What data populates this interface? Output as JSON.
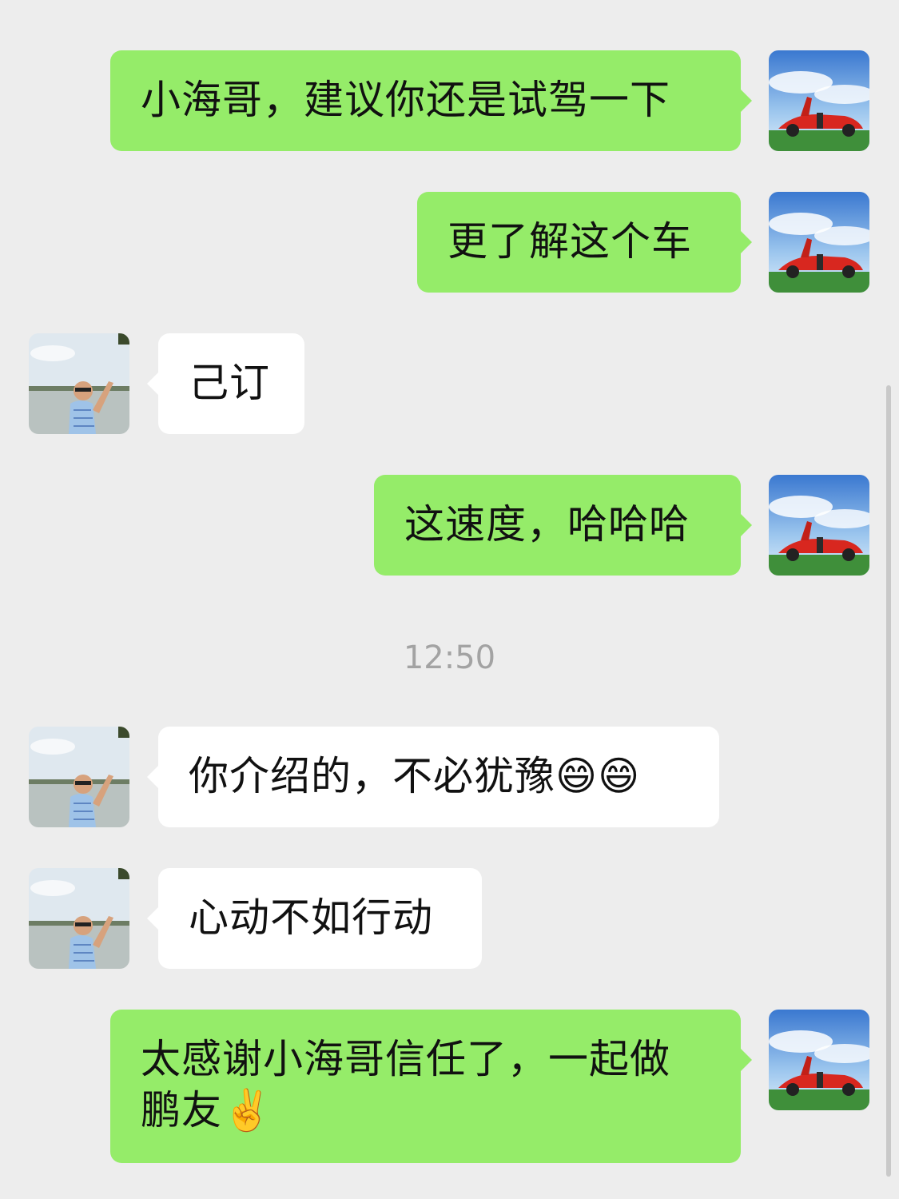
{
  "messages": [
    {
      "side": "out",
      "text": "小海哥，建议你还是试驾一下",
      "avatar": "red-sports-car-avatar"
    },
    {
      "side": "out",
      "text": "更了解这个车",
      "avatar": "red-sports-car-avatar"
    },
    {
      "side": "in",
      "text": "己订",
      "avatar": "man-by-river-avatar"
    },
    {
      "side": "out",
      "text": "这速度，哈哈哈",
      "avatar": "red-sports-car-avatar"
    },
    {
      "side": "in",
      "text": "你介绍的，不必犹豫",
      "emoji": "😄😄",
      "avatar": "man-by-river-avatar"
    },
    {
      "side": "in",
      "text": "心动不如行动",
      "avatar": "man-by-river-avatar"
    },
    {
      "side": "out",
      "text_line1": "太感谢小海哥信任了，一起做",
      "text_line2": "鹏友",
      "emoji": "✌️",
      "avatar": "red-sports-car-avatar"
    }
  ],
  "timestamp": "12:50",
  "colors": {
    "background": "#ededed",
    "outgoing_bubble": "#95ec69",
    "incoming_bubble": "#ffffff",
    "timestamp_text": "#a3a3a3"
  }
}
